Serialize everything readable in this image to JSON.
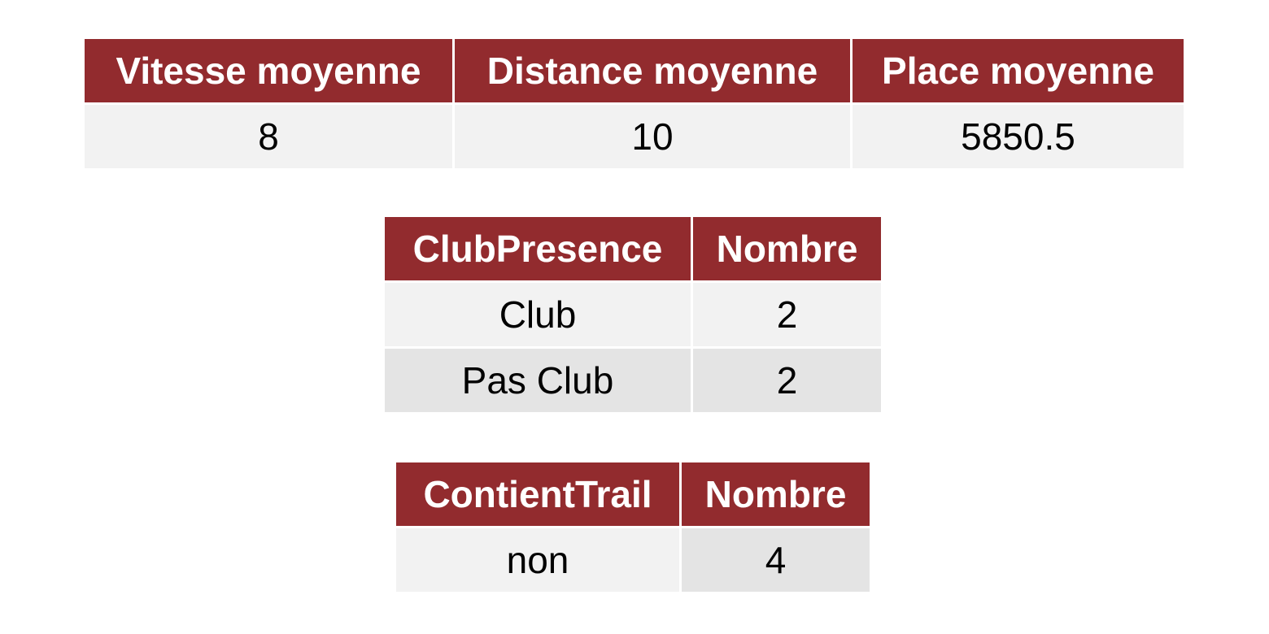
{
  "summary_table": {
    "headers": [
      "Vitesse moyenne",
      "Distance moyenne",
      "Place moyenne"
    ],
    "row": [
      "8",
      "10",
      "5850.5"
    ]
  },
  "club_table": {
    "headers": [
      "ClubPresence",
      "Nombre"
    ],
    "rows": [
      [
        "Club",
        "2"
      ],
      [
        "Pas Club",
        "2"
      ]
    ]
  },
  "trail_table": {
    "headers": [
      "ContientTrail",
      "Nombre"
    ],
    "rows": [
      [
        "non",
        "4"
      ]
    ]
  },
  "colors": {
    "header_bg": "#922b2e",
    "header_text": "#ffffff",
    "row_light": "#f2f2f2",
    "row_dark": "#e4e4e4"
  }
}
